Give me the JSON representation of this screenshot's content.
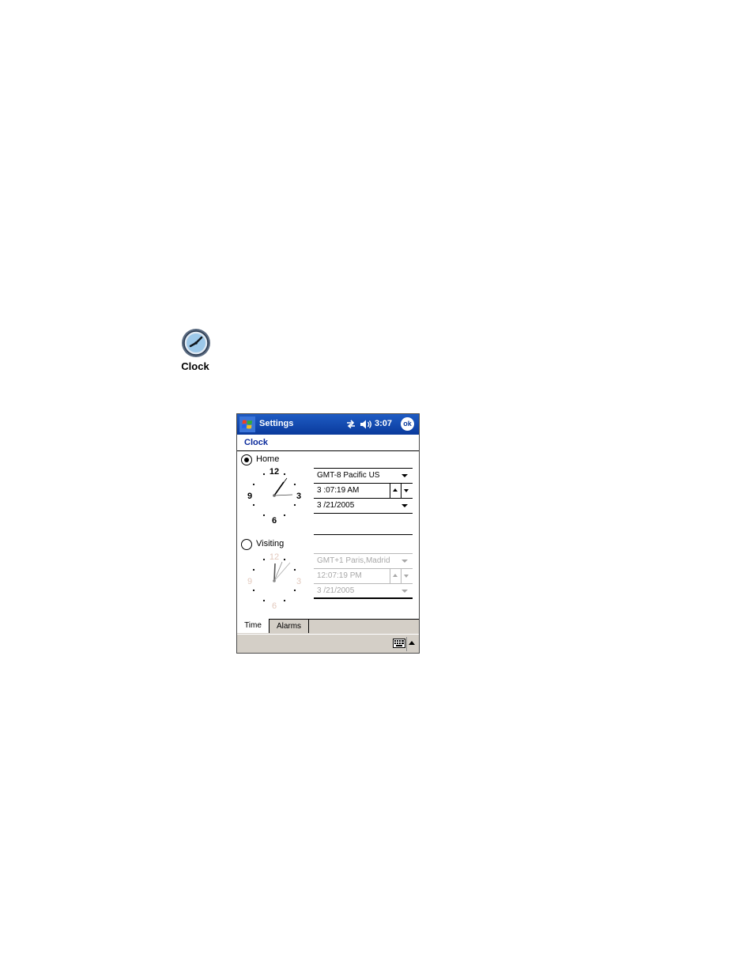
{
  "app_icon": {
    "label": "Clock",
    "icon": "clock-icon"
  },
  "title_bar": {
    "title": "Settings",
    "time": "3:07",
    "ok_label": "ok",
    "icons": [
      "windows-start-icon",
      "connectivity-icon",
      "volume-icon"
    ],
    "color": "#0a3a9c"
  },
  "page": {
    "title": "Clock"
  },
  "home": {
    "label": "Home",
    "selected": true,
    "timezone": "GMT-8 Pacific US",
    "time": "3 :07:19 AM",
    "date": "3 /21/2005",
    "dial": {
      "n12": "12",
      "n3": "3",
      "n6": "6",
      "n9": "9"
    }
  },
  "visiting": {
    "label": "Visiting",
    "selected": false,
    "timezone": "GMT+1 Paris,Madrid",
    "time": "12:07:19 PM",
    "date": "3 /21/2005",
    "dial": {
      "n12": "12",
      "n3": "3",
      "n6": "6",
      "n9": "9"
    }
  },
  "tabs": [
    {
      "label": "Time",
      "active": true
    },
    {
      "label": "Alarms",
      "active": false
    }
  ],
  "menu_bar": {
    "icons": [
      "keyboard-icon",
      "sip-arrow-icon"
    ]
  }
}
